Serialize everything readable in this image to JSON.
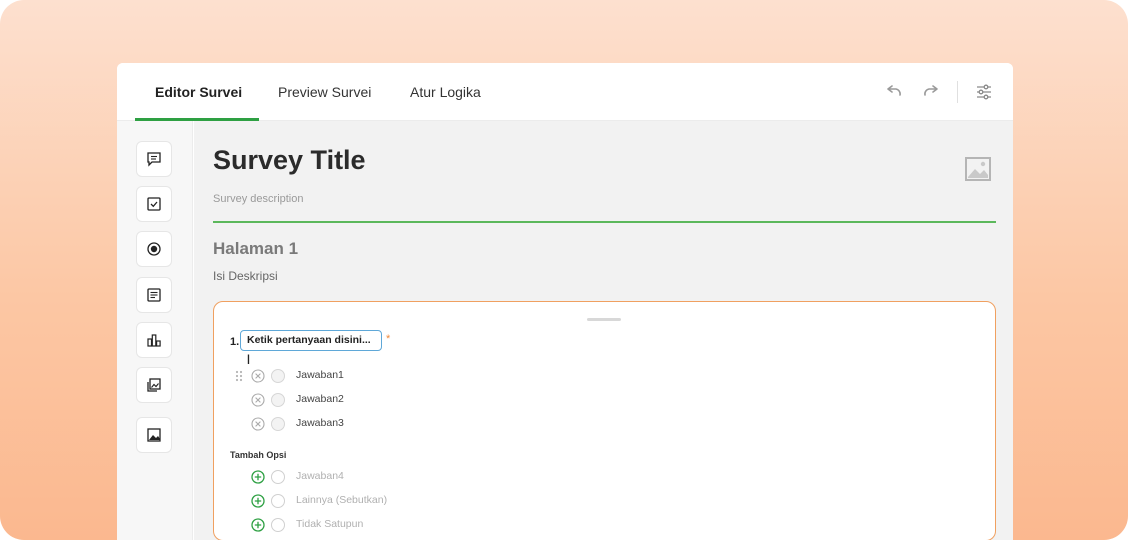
{
  "tabs": [
    {
      "label": "Editor Survei",
      "active": true
    },
    {
      "label": "Preview Survei",
      "active": false
    },
    {
      "label": "Atur Logika",
      "active": false
    }
  ],
  "toolbar": {
    "icons": [
      "undo-icon",
      "redo-icon",
      "settings-sliders-icon"
    ]
  },
  "sidebar": {
    "items": [
      {
        "icon": "comment-icon"
      },
      {
        "icon": "checkbox-icon"
      },
      {
        "icon": "radio-icon"
      },
      {
        "icon": "text-area-icon"
      },
      {
        "icon": "bar-chart-icon"
      },
      {
        "icon": "gallery-icon"
      },
      {
        "icon": "image-icon"
      }
    ]
  },
  "survey": {
    "title": "Survey Title",
    "description": "Survey description"
  },
  "page": {
    "title": "Halaman 1",
    "description": "Isi Deskripsi"
  },
  "question": {
    "number": "1.",
    "placeholder": "Ketik pertanyaan disini... |",
    "required_mark": "*",
    "options": [
      "Jawaban1",
      "Jawaban2",
      "Jawaban3"
    ],
    "add_section_label": "Tambah Opsi",
    "add_options": [
      "Jawaban4",
      "Lainnya (Sebutkan)",
      "Tidak Satupun"
    ]
  },
  "colors": {
    "accent_green": "#2ea043",
    "card_border": "#f0a060",
    "input_border": "#5fa8d8"
  }
}
